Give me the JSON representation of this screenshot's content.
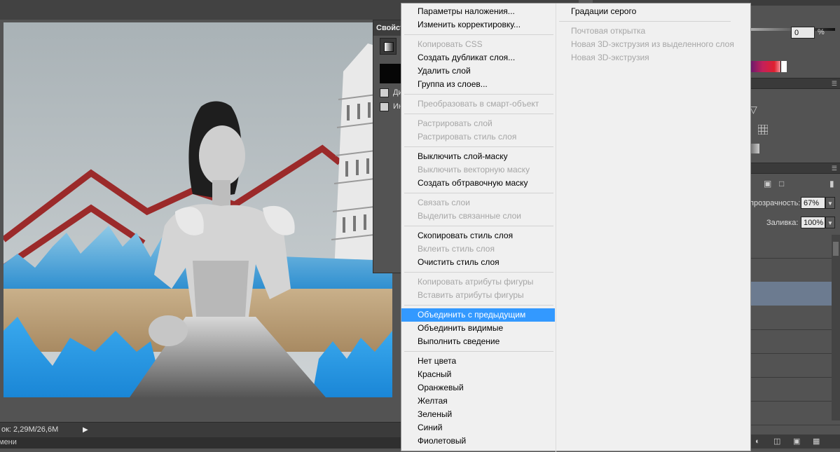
{
  "status": {
    "doc_size": "ок: 2,29M/26,6M",
    "tab_label": "мени"
  },
  "properties_panel": {
    "title": "Свойст",
    "checkbox1_label": "Ди",
    "checkbox2_label": "Ин"
  },
  "right_panel": {
    "percent_value": "0",
    "percent_sign": "%",
    "opacity_label": "прозрачность:",
    "opacity_value": "67%",
    "fill_label": "Заливка:",
    "fill_value": "100%"
  },
  "context_menu": {
    "left_column": [
      {
        "label": "Параметры наложения...",
        "enabled": true
      },
      {
        "label": "Изменить корректировку...",
        "enabled": true
      },
      {
        "label": "Копировать CSS",
        "enabled": false
      },
      {
        "label": "Создать дубликат слоя...",
        "enabled": true
      },
      {
        "label": "Удалить слой",
        "enabled": true
      },
      {
        "label": "Группа из слоев...",
        "enabled": true
      },
      {
        "label": "Преобразовать в смарт-объект",
        "enabled": false
      },
      {
        "label": "Растрировать слой",
        "enabled": false
      },
      {
        "label": "Растрировать стиль слоя",
        "enabled": false
      },
      {
        "label": "Выключить слой-маску",
        "enabled": true
      },
      {
        "label": "Выключить векторную маску",
        "enabled": false
      },
      {
        "label": "Создать обтравочную маску",
        "enabled": true
      },
      {
        "label": "Связать слои",
        "enabled": false
      },
      {
        "label": "Выделить связанные слои",
        "enabled": false
      },
      {
        "label": "Скопировать стиль слоя",
        "enabled": true
      },
      {
        "label": "Вклеить стиль слоя",
        "enabled": false
      },
      {
        "label": "Очистить стиль слоя",
        "enabled": true
      },
      {
        "label": "Копировать атрибуты фигуры",
        "enabled": false
      },
      {
        "label": "Вставить атрибуты фигуры",
        "enabled": false
      },
      {
        "label": "Объединить с предыдущим",
        "enabled": true,
        "highlighted": true
      },
      {
        "label": "Объединить видимые",
        "enabled": true
      },
      {
        "label": "Выполнить сведение",
        "enabled": true
      },
      {
        "label": "Нет цвета",
        "enabled": true
      },
      {
        "label": "Красный",
        "enabled": true
      },
      {
        "label": "Оранжевый",
        "enabled": true
      },
      {
        "label": "Желтая",
        "enabled": true
      },
      {
        "label": "Зеленый",
        "enabled": true
      },
      {
        "label": "Синий",
        "enabled": true
      },
      {
        "label": "Фиолетовый",
        "enabled": true
      }
    ],
    "right_column": [
      {
        "label": "Градации серого",
        "enabled": true
      },
      {
        "label": "Почтовая открытка",
        "enabled": false
      },
      {
        "label": "Новая 3D-экструзия из выделенного слоя",
        "enabled": false
      },
      {
        "label": "Новая 3D-экструзия",
        "enabled": false
      }
    ]
  },
  "colors": {
    "highlight": "#3399ff",
    "menu_bg": "#f0f0f0",
    "workspace_bg": "#535353",
    "zigzag_red": "#9b2a2a",
    "water_blue": "#2aa0e8"
  }
}
